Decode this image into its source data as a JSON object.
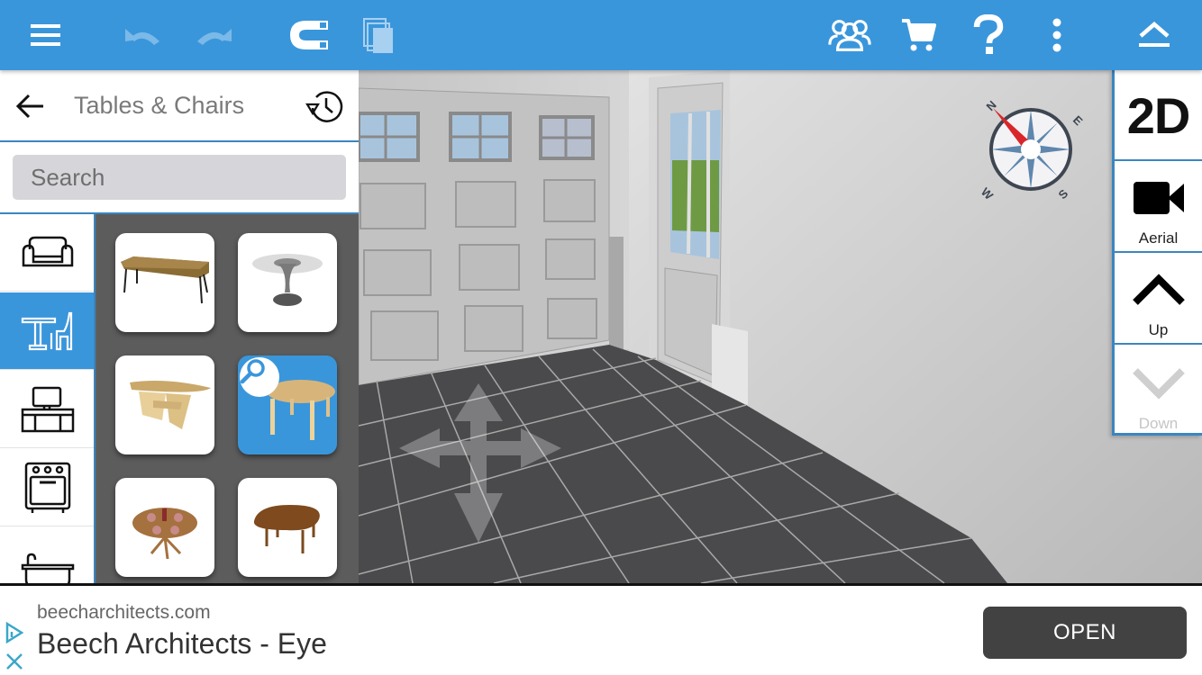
{
  "toolbar": {
    "icons": [
      "menu-icon",
      "undo-icon",
      "redo-icon",
      "magnet-snap-icon",
      "copy-icon",
      "community-icon",
      "cart-icon",
      "help-icon",
      "more-vertical-icon",
      "eject-collapse-icon"
    ],
    "undo_enabled": false,
    "redo_enabled": false,
    "copy_enabled": false,
    "accent_color": "#3a96db"
  },
  "panel": {
    "title": "Tables & Chairs",
    "back_icon": "arrow-left-icon",
    "history_icon": "history-icon",
    "search": {
      "placeholder": "Search",
      "value": ""
    },
    "categories": [
      {
        "name": "sofas",
        "icon": "sofa-icon",
        "active": false
      },
      {
        "name": "tables-chairs",
        "icon": "table-chair-icon",
        "active": true
      },
      {
        "name": "tv-media",
        "icon": "tv-stand-icon",
        "active": false
      },
      {
        "name": "kitchen",
        "icon": "oven-icon",
        "active": false
      },
      {
        "name": "bathroom",
        "icon": "bathtub-icon",
        "active": false
      }
    ],
    "items": [
      {
        "name": "long-wooden-table",
        "selected": false
      },
      {
        "name": "glass-tulip-table",
        "selected": false
      },
      {
        "name": "half-round-console-table",
        "selected": false
      },
      {
        "name": "round-wood-table",
        "selected": true,
        "badge": "magnifier-icon"
      },
      {
        "name": "round-dining-table-set",
        "selected": false
      },
      {
        "name": "oval-walnut-table",
        "selected": false
      }
    ]
  },
  "view_controls": {
    "mode_2d": "2D",
    "aerial": "Aerial",
    "up": "Up",
    "down": "Down",
    "down_enabled": false
  },
  "compass": {
    "labels": [
      "N",
      "E",
      "S",
      "W"
    ],
    "needle_color": "#d9262a"
  },
  "ad": {
    "domain": "beecharchitects.com",
    "title": "Beech Architects - Eye",
    "cta": "OPEN",
    "choices_icon": "ad-choices-icon",
    "close_icon": "close-icon"
  }
}
